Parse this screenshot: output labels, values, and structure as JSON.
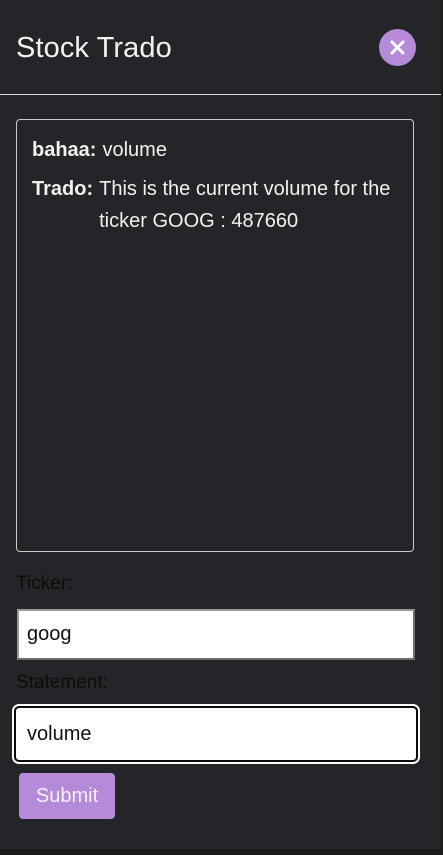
{
  "header": {
    "title": "Stock Trado",
    "close_icon": "close-icon"
  },
  "chat": {
    "messages": [
      {
        "sender": "bahaa:",
        "text": "volume"
      },
      {
        "sender": "Trado:",
        "text": "This is the current volume for the ticker GOOG : 487660"
      }
    ]
  },
  "form": {
    "ticker_label": "Ticker:",
    "ticker_value": "goog",
    "statement_label": "Statement:",
    "statement_value": "volume",
    "submit_label": "Submit"
  },
  "colors": {
    "accent": "#b48ad9",
    "panel_background": "#242528"
  }
}
